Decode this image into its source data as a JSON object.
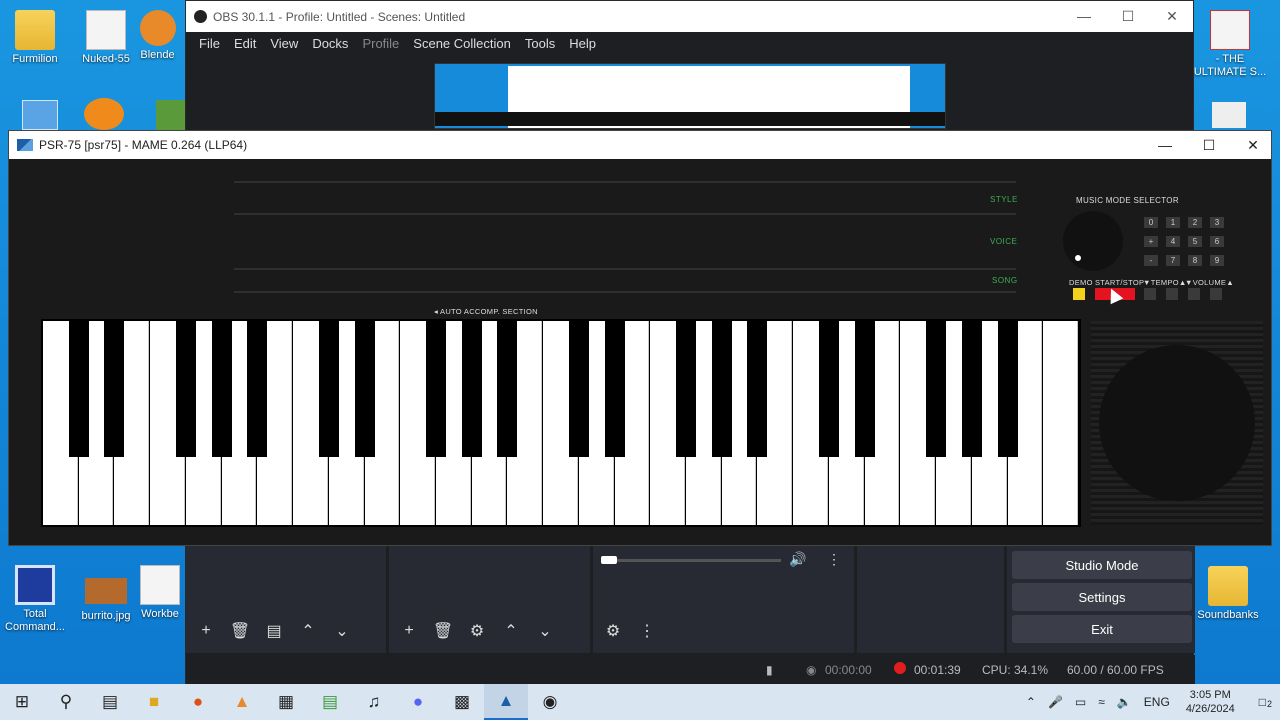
{
  "desktop": {
    "left_icons": [
      {
        "label": "Furmilion",
        "icon": "person-folder-icon"
      },
      {
        "label": "Nuked-55",
        "icon": "app-icon"
      },
      {
        "label": "Blende",
        "icon": "blender-icon"
      },
      {
        "label": "Total Command...",
        "icon": "floppy-icon"
      },
      {
        "label": "burrito.jpg",
        "icon": "image-icon"
      },
      {
        "label": "Workbe",
        "icon": "gear-app-icon"
      }
    ],
    "right_icons": [
      {
        "label": "- THE ULTIMATE S...",
        "icon": "pdf-icon"
      },
      {
        "label": "Soundbanks",
        "icon": "folder-icon"
      }
    ]
  },
  "obs": {
    "title": "OBS 30.1.1 - Profile: Untitled - Scenes: Untitled",
    "menu": [
      "File",
      "Edit",
      "View",
      "Docks",
      "Profile",
      "Scene Collection",
      "Tools",
      "Help"
    ],
    "buttons": {
      "studio_mode": "Studio Mode",
      "settings": "Settings",
      "exit": "Exit"
    },
    "status": {
      "stream_time": "00:00:00",
      "rec_time": "00:01:39",
      "cpu": "CPU: 34.1%",
      "fps": "60.00 / 60.00 FPS"
    }
  },
  "mame": {
    "title": "PSR-75 [psr75] - MAME 0.264 (LLP64)",
    "labels": {
      "style": "STYLE",
      "voice": "VOICE",
      "song": "SONG",
      "music_mode": "MUSIC MODE SELECTOR",
      "auto_accomp": "◂ AUTO ACCOMP. SECTION",
      "demo": "DEMO",
      "start_stop": "START/STOP",
      "tempo": "▼TEMPO▲",
      "volume": "▼VOLUME▲"
    },
    "numpad": [
      "0",
      "1",
      "2",
      "3",
      "+",
      "4",
      "5",
      "6",
      "-",
      "7",
      "8",
      "9"
    ],
    "colors": {
      "style_label": "#3fae52",
      "demo_button": "#f2d21b",
      "start_stop_button": "#e3141f",
      "record_dot": "#e01e1e"
    }
  },
  "taskbar": {
    "language": "ENG",
    "time": "3:05 PM",
    "date": "4/26/2024",
    "notifications": "2"
  }
}
